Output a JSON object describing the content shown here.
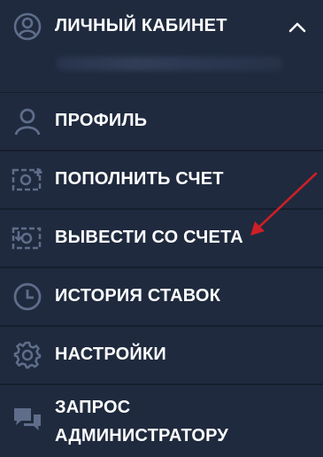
{
  "header": {
    "title": "ЛИЧНЫЙ КАБИНЕТ",
    "icon": "user-circle-icon",
    "toggle_icon": "chevron-up-icon"
  },
  "menu": {
    "items": [
      {
        "label": "ПРОФИЛЬ",
        "icon": "user-icon"
      },
      {
        "label": "ПОПОЛНИТЬ СЧЕТ",
        "icon": "deposit-icon"
      },
      {
        "label": "ВЫВЕСТИ СО СЧЕТА",
        "icon": "withdraw-icon"
      },
      {
        "label": "ИСТОРИЯ СТАВОК",
        "icon": "clock-icon"
      },
      {
        "label": "НАСТРОЙКИ",
        "icon": "gear-icon"
      },
      {
        "label_line1": "ЗАПРОС",
        "label_line2": "АДМИНИСТРАТОРУ",
        "icon": "chat-icon"
      }
    ]
  },
  "colors": {
    "background": "#1f2a3e",
    "divider": "#161e2d",
    "icon": "#5f6d8a",
    "text": "#ffffff",
    "annotation_arrow": "#cc1f26"
  }
}
